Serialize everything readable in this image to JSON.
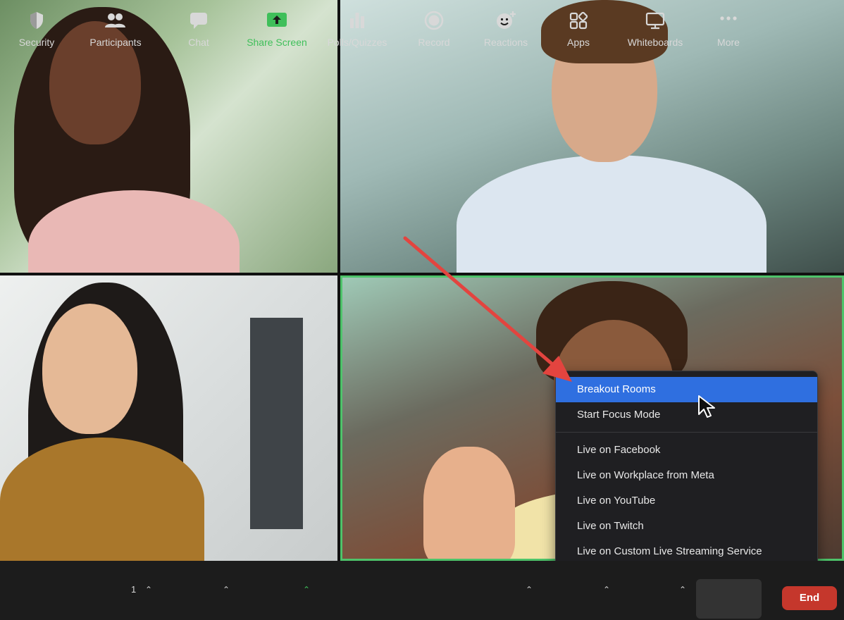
{
  "more_menu": {
    "items": [
      {
        "label": "Breakout Rooms",
        "active": true
      },
      {
        "label": "Start Focus Mode",
        "active": false
      },
      {
        "label": "Live on Facebook",
        "active": false
      },
      {
        "label": "Live on Workplace from Meta",
        "active": false
      },
      {
        "label": "Live on YouTube",
        "active": false
      },
      {
        "label": "Live on Twitch",
        "active": false
      },
      {
        "label": "Live on Custom Live Streaming Service",
        "active": false
      }
    ]
  },
  "toolbar": {
    "security": "Security",
    "participants": "Participants",
    "participants_count": "1",
    "chat": "Chat",
    "share_screen": "Share Screen",
    "polls": "Polls/Quizzes",
    "record": "Record",
    "reactions": "Reactions",
    "apps": "Apps",
    "whiteboards": "Whiteboards",
    "more": "More",
    "end": "End"
  },
  "colors": {
    "highlight": "#2f6fe0",
    "active_speaker_border": "#4ec36a",
    "share_green": "#3fbf5a",
    "end_red": "#c5372c",
    "arrow": "#e3443f"
  }
}
